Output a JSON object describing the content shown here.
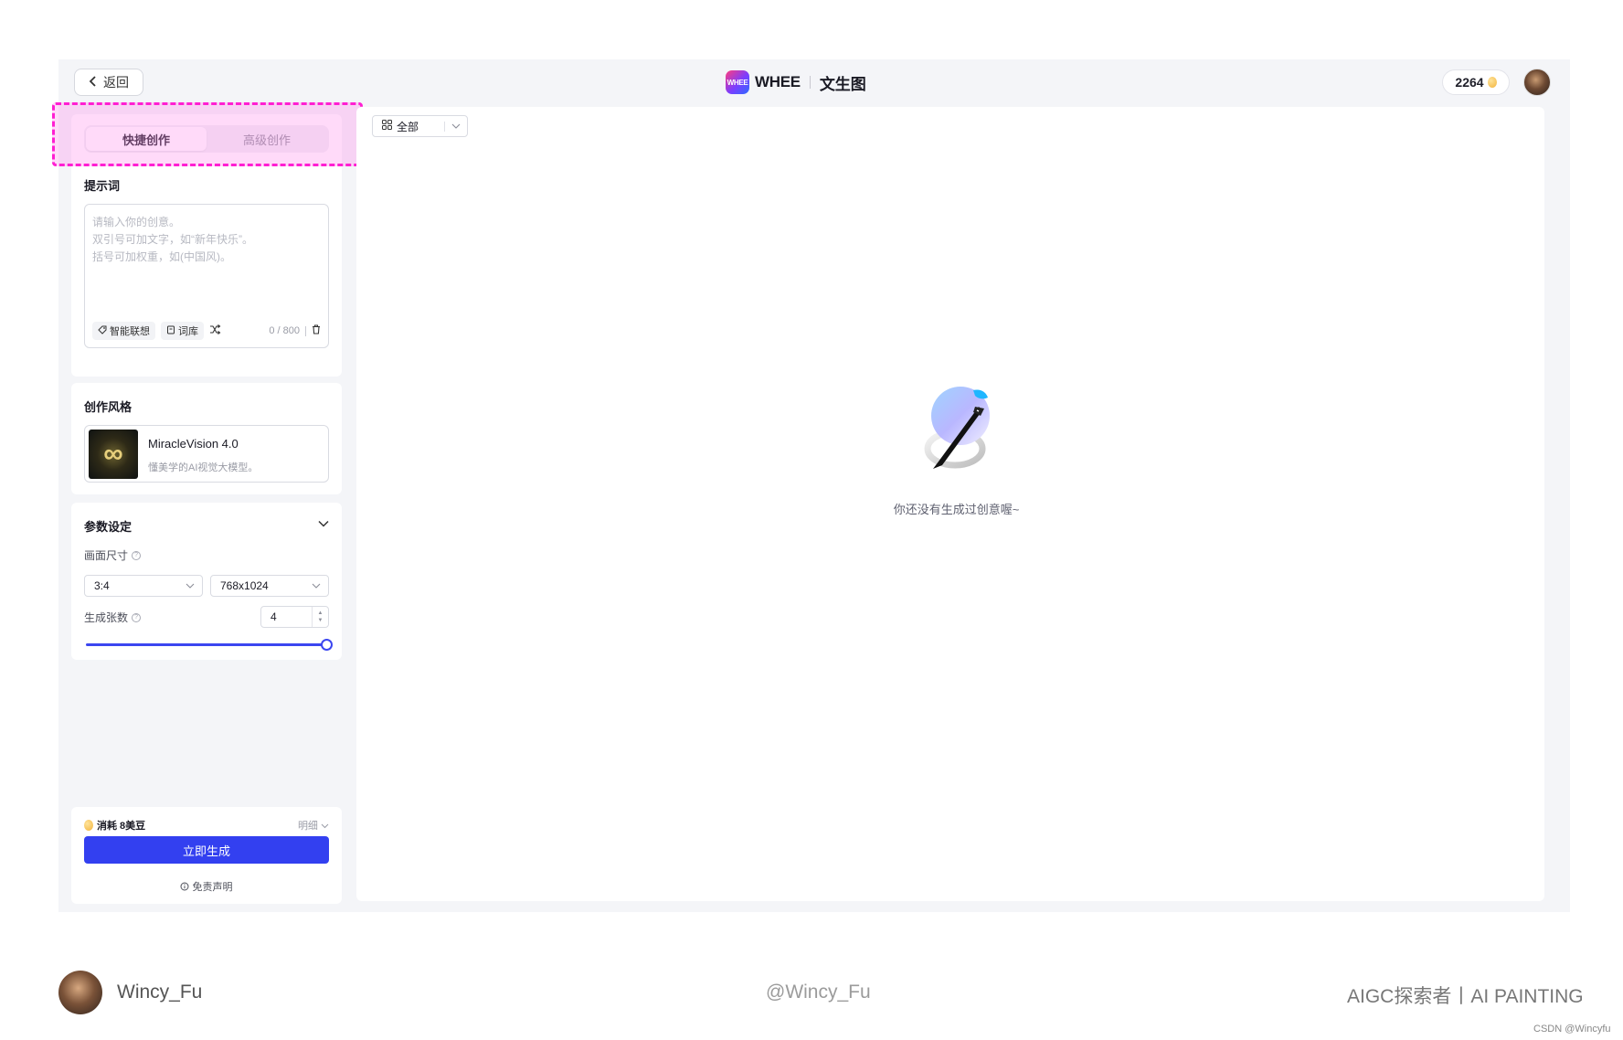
{
  "topbar": {
    "back_label": "返回",
    "logo_mark_text": "WHEE",
    "logo_text": "WHEE",
    "page_title": "文生图",
    "credits": "2264"
  },
  "tabs": [
    {
      "label": "快捷创作",
      "active": true
    },
    {
      "label": "高级创作",
      "active": false
    }
  ],
  "prompt": {
    "section_label": "提示词",
    "placeholder": "请输入你的创意。\n双引号可加文字，如“新年快乐”。\n括号可加权重，如(中国风)。",
    "tool_smart": "智能联想",
    "tool_lexicon": "词库",
    "counter": "0 / 800"
  },
  "style": {
    "section_label": "创作风格",
    "model_name": "MiracleVision 4.0",
    "model_desc": "懂美学的AI视觉大模型。"
  },
  "params": {
    "section_label": "参数设定",
    "size_label": "画面尺寸",
    "ratio_value": "3:4",
    "resolution_value": "768x1024",
    "count_label": "生成张数",
    "count_value": "4",
    "count_slider_fraction": 1.0
  },
  "generate": {
    "cost_label": "消耗 8美豆",
    "detail_label": "明细",
    "button_label": "立即生成",
    "disclaimer": "免责声明"
  },
  "main": {
    "filter_label": "全部",
    "empty_text": "你还没有生成过创意喔~"
  },
  "footer": {
    "name": "Wincy_Fu",
    "handle": "@Wincy_Fu",
    "tag": "AIGC探索者丨AI PAINTING",
    "watermark": "CSDN @Wincyfu"
  },
  "colors": {
    "accent": "#3340f0",
    "highlight_border": "#ff1fd2",
    "highlight_fill": "#ff8ceb"
  },
  "icons": [
    "chevron-left-icon",
    "bean-icon",
    "grid-icon",
    "chevron-down-icon",
    "tag-icon",
    "book-icon",
    "shuffle-icon",
    "trash-icon",
    "help-icon",
    "info-icon",
    "brush-illustration"
  ]
}
